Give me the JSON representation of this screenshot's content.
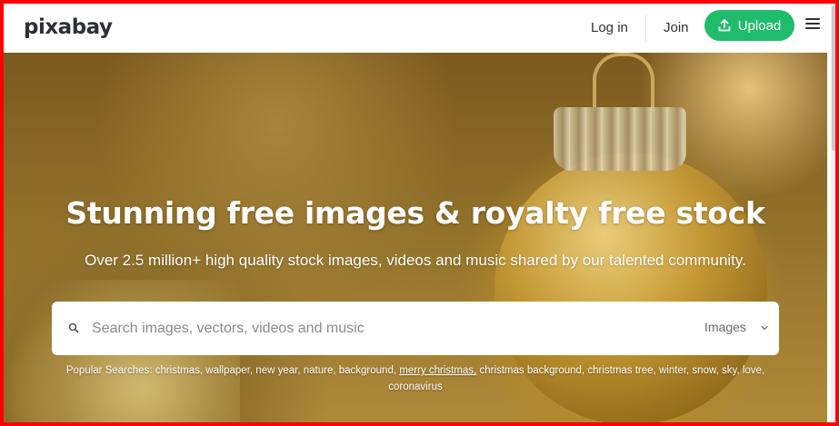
{
  "header": {
    "logo": "pixabay",
    "login_label": "Log in",
    "join_label": "Join",
    "upload_label": "Upload",
    "upload_color": "#1fbc6c"
  },
  "hero": {
    "title": "Stunning free images & royalty free stock",
    "subtitle": "Over 2.5 million+ high quality stock images, videos and music shared by our talented community."
  },
  "search": {
    "placeholder": "Search images, vectors, videos and music",
    "value": "",
    "type_selected": "Images"
  },
  "popular": {
    "label": "Popular Searches:",
    "tags": [
      "christmas,",
      "wallpaper,",
      "new year,",
      "nature,",
      "background,",
      "merry christmas,",
      "christmas background,",
      "christmas tree,",
      "winter,",
      "snow,",
      "sky,",
      "love,",
      "coronavirus"
    ],
    "underlined_tag": "merry christmas,"
  },
  "icons": {
    "upload": "upload-icon",
    "menu": "hamburger-menu-icon",
    "search": "search-icon",
    "dropdown": "chevron-down-icon"
  }
}
